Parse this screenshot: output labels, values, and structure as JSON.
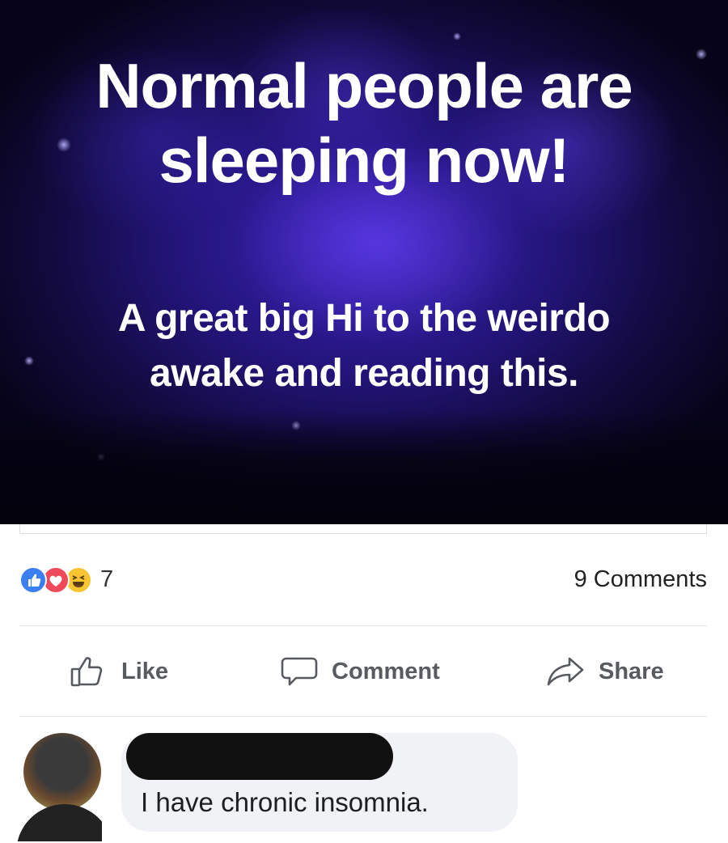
{
  "post": {
    "image": {
      "headline_lines": [
        "Normal people are",
        "sleeping now!"
      ],
      "subtext_lines": [
        "A great big Hi to the weirdo",
        "awake and reading this."
      ],
      "background_colors": [
        "#07041a",
        "#231479",
        "#3a22b8"
      ]
    },
    "reactions": {
      "icons": [
        "like-icon",
        "love-icon",
        "haha-icon"
      ],
      "count": "7"
    },
    "comments_count_label": "9 Comments",
    "actions": {
      "like_label": "Like",
      "comment_label": "Comment",
      "share_label": "Share"
    }
  },
  "comment": {
    "author_redacted": true,
    "text": "I have chronic insomnia."
  },
  "colors": {
    "like_blue": "#3b7ff2",
    "love_red": "#ef4a5c",
    "haha_yellow": "#f7c531",
    "action_gray": "#575a5f",
    "bubble_bg": "#f0f2f5"
  }
}
